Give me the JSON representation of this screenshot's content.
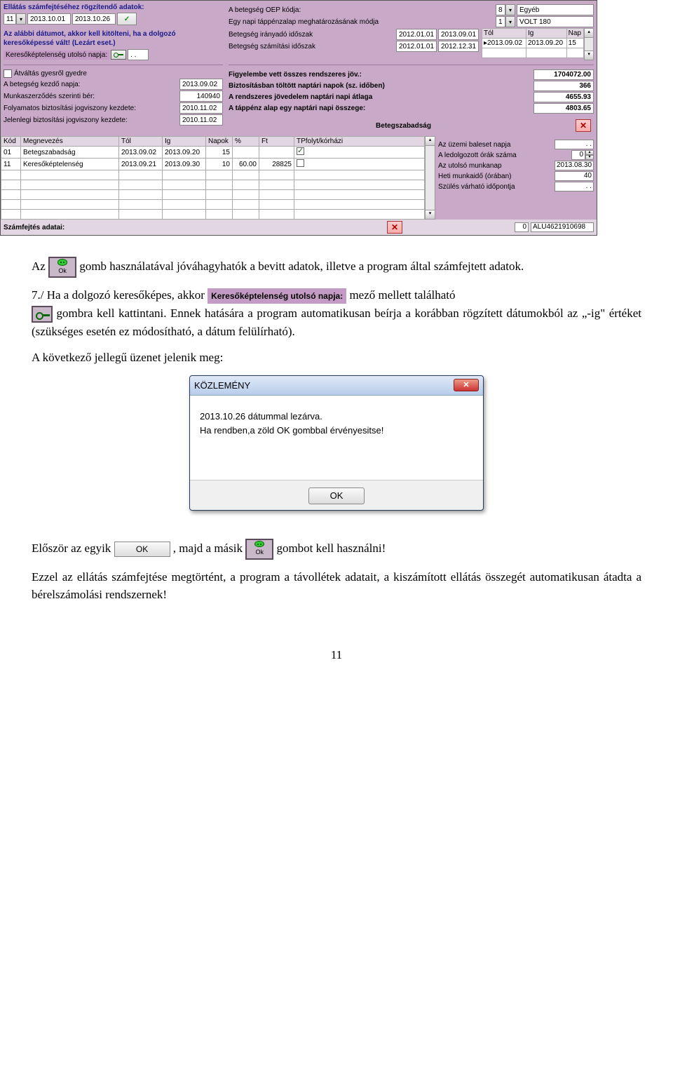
{
  "app": {
    "header": {
      "title": "Ellátás számfejtéséhez rögzítendő adatok:",
      "code": "11",
      "date1": "2013.10.01",
      "date2": "2013.10.26"
    },
    "note": "Az alábbi dátumot, akkor kell kitölteni, ha a dolgozó keresőképessé vált! (Lezárt eset.)",
    "lastday_label": "Keresőképtelenség utolsó napja:",
    "lastday_value": ". .",
    "left_rows": {
      "atv": "Átváltás gyesről gyedre",
      "bet_kezd": {
        "lab": "A betegség kezdő napja:",
        "val": "2013.09.02"
      },
      "munk": {
        "lab": "Munkaszerződés szerinti bér:",
        "val": "140940"
      },
      "foly": {
        "lab": "Folyamatos biztosítási jogviszony kezdete:",
        "val": "2010.11.02"
      },
      "jel": {
        "lab": "Jelenlegi biztosítási jogviszony kezdete:",
        "val": "2010.11.02"
      }
    },
    "right_rows": {
      "oep": {
        "lab": "A betegség OEP kódja:",
        "code": "8",
        "txt": "Egyéb"
      },
      "egynapi": {
        "lab": "Egy napi táppénzalap meghatározásának módja",
        "code": "1",
        "txt": "VOLT 180"
      },
      "iranyado": {
        "lab": "Betegség irányadó időszak",
        "d1": "2012.01.01",
        "d2": "2013.09.01"
      },
      "szamitasi": {
        "lab": "Betegség számítási időszak",
        "d1": "2012.01.01",
        "d2": "2012.12.31"
      },
      "figyelembe": {
        "lab": "Figyelembe vett összes rendszeres jöv.:",
        "val": "1704072.00"
      },
      "biztositasban": {
        "lab": "Biztosításban töltött naptári napok (sz. időben)",
        "val": "366"
      },
      "arendszeres": {
        "lab": "A rendszeres jövedelem naptári napi átlaga",
        "val": "4655.93"
      },
      "atappenz": {
        "lab": "A táppénz alap egy naptári napi összege:",
        "val": "4803.65"
      }
    },
    "mini_table": {
      "h1": "Tól",
      "h2": "Ig",
      "h3": "Nap",
      "r1_d1": "2013.09.02",
      "r1_d2": "2013.09.20",
      "r1_n": "15"
    },
    "status_label": "Betegszabadság",
    "big_table": {
      "headers": {
        "kod": "Kód",
        "megn": "Megnevezés",
        "tol": "Tól",
        "ig": "Ig",
        "napok": "Napok",
        "pct": "%",
        "ft": "Ft",
        "tp": "TPfolyt/kórházi"
      },
      "rows": [
        {
          "kod": "01",
          "megn": "Betegszabadság",
          "tol": "2013.09.02",
          "ig": "2013.09.20",
          "napok": "15",
          "pct": "",
          "ft": "",
          "tp": true
        },
        {
          "kod": "11",
          "megn": "Keresőképtelenség",
          "tol": "2013.09.21",
          "ig": "2013.09.30",
          "napok": "10",
          "pct": "60.00",
          "ft": "28825",
          "tp": false
        }
      ]
    },
    "right_panel": {
      "r1": {
        "lab": "Az üzemi baleset napja",
        "val": ". ."
      },
      "r2": {
        "lab": "A ledolgozott órák száma",
        "val": "0"
      },
      "r3": {
        "lab": "Az utolsó munkanap",
        "val": "2013.08.30"
      },
      "r4": {
        "lab": "Heti munkaidő (órában)",
        "val": "40"
      },
      "r5": {
        "lab": "Szülés várható időpontja",
        "val": ". ."
      }
    },
    "footer": {
      "szamf": "Számfejtés adatai:",
      "num": "0",
      "code": "ALU4621910698"
    }
  },
  "doc": {
    "p1a": "Az ",
    "p1b": " gomb használatával jóváhagyhatók a bevitt adatok, illetve a program által számfejtett adatok.",
    "p2a": "7./ Ha a dolgozó keresőképes, akkor ",
    "p2tag": "Keresőképtelenség utolsó napja:",
    "p2b": " mező mellett található ",
    "p2c": " gombra kell kattintani. Ennek hatására a program automatikusan beírja a korábban rögzített dátumokból az „-ig\" értéket (szükséges esetén ez módosítható, a dátum felülírható).",
    "p3": "A következő jellegű üzenet jelenik meg:",
    "p4a": "Először az egyik ",
    "p4b": ", majd a másik ",
    "p4c": " gombot kell használni!",
    "p5": "Ezzel az ellátás számfejtése megtörtént, a program a távollétek adatait, a kiszámított ellátás összegét automatikusan átadta a bérelszámolási rendszernek!",
    "oklabel": "Ok",
    "okbtnlabel": "OK"
  },
  "dialog": {
    "title": "KÖZLEMÉNY",
    "line1": "2013.10.26 dátummal lezárva.",
    "line2": "Ha rendben,a zöld OK gombbal érvényesitse!",
    "ok": "OK"
  },
  "pagenum": "11"
}
